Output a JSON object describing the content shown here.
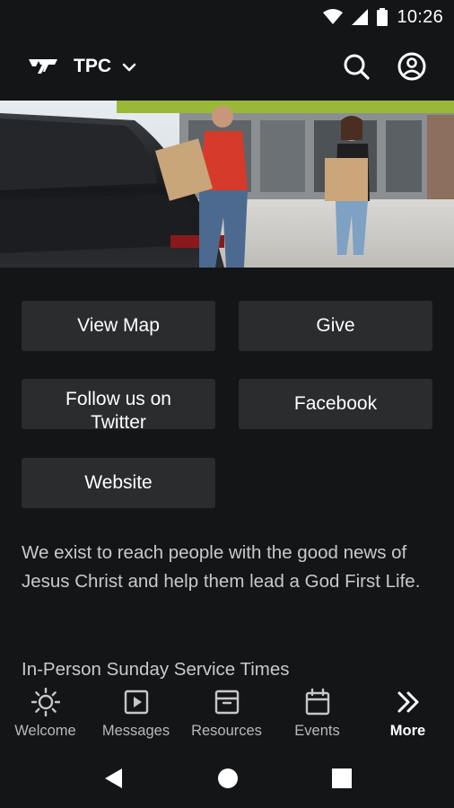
{
  "status_bar": {
    "time": "10:26"
  },
  "header": {
    "org_name": "TPC"
  },
  "buttons": {
    "view_map": "View Map",
    "give": "Give",
    "follow_twitter": "Follow us on Twitter",
    "facebook": "Facebook",
    "website": "Website"
  },
  "content": {
    "description": "We exist to reach people with the good news of Jesus Christ and help them lead a God First Life.",
    "service_heading": "In-Person Sunday Service Times"
  },
  "tabs": [
    {
      "label": "Welcome",
      "icon": "sun-icon"
    },
    {
      "label": "Messages",
      "icon": "play-icon"
    },
    {
      "label": "Resources",
      "icon": "archive-icon"
    },
    {
      "label": "Events",
      "icon": "calendar-icon"
    },
    {
      "label": "More",
      "icon": "double-chevron-icon",
      "active": true
    }
  ],
  "colors": {
    "background": "#141517",
    "button": "#2b2c2e",
    "text_muted": "#c9c9cb"
  }
}
